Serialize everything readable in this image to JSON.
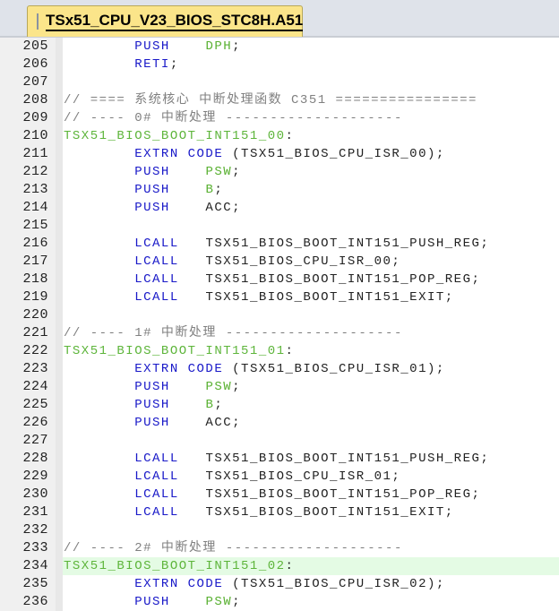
{
  "tab": {
    "title": "TSx51_CPU_V23_BIOS_STC8H.A51"
  },
  "colors": {
    "keyword": "#1818c8",
    "operand": "#58b030",
    "comment": "#808080",
    "label": "#5db53a",
    "highlight": "#e4fbe4"
  },
  "highlighted_line": 234,
  "lines": [
    {
      "n": "205",
      "s": [
        [
          "        ",
          "tx"
        ],
        [
          "PUSH",
          "kw"
        ],
        [
          "    ",
          "tx"
        ],
        [
          "DPH",
          "op"
        ],
        [
          ";",
          "tx"
        ]
      ]
    },
    {
      "n": "206",
      "s": [
        [
          "        ",
          "tx"
        ],
        [
          "RETI",
          "kw"
        ],
        [
          ";",
          "tx"
        ]
      ]
    },
    {
      "n": "207",
      "s": []
    },
    {
      "n": "208",
      "s": [
        [
          "// ==== 系统核心 中断处理函数 C351 ================",
          "cm"
        ]
      ]
    },
    {
      "n": "209",
      "s": [
        [
          "// ---- 0# 中断处理 --------------------",
          "cm"
        ]
      ]
    },
    {
      "n": "210",
      "s": [
        [
          "TSX51_BIOS_BOOT_INT151_00",
          "lb"
        ],
        [
          ":",
          "tx"
        ]
      ]
    },
    {
      "n": "211",
      "s": [
        [
          "        ",
          "tx"
        ],
        [
          "EXTRN CODE",
          "kw"
        ],
        [
          " (TSX51_BIOS_CPU_ISR_00);",
          "tx"
        ]
      ]
    },
    {
      "n": "212",
      "s": [
        [
          "        ",
          "tx"
        ],
        [
          "PUSH",
          "kw"
        ],
        [
          "    ",
          "tx"
        ],
        [
          "PSW",
          "op"
        ],
        [
          ";",
          "tx"
        ]
      ]
    },
    {
      "n": "213",
      "s": [
        [
          "        ",
          "tx"
        ],
        [
          "PUSH",
          "kw"
        ],
        [
          "    ",
          "tx"
        ],
        [
          "B",
          "op"
        ],
        [
          ";",
          "tx"
        ]
      ]
    },
    {
      "n": "214",
      "s": [
        [
          "        ",
          "tx"
        ],
        [
          "PUSH",
          "kw"
        ],
        [
          "    ACC;",
          "tx"
        ]
      ]
    },
    {
      "n": "215",
      "s": []
    },
    {
      "n": "216",
      "s": [
        [
          "        ",
          "tx"
        ],
        [
          "LCALL",
          "kw"
        ],
        [
          "   TSX51_BIOS_BOOT_INT151_PUSH_REG;",
          "tx"
        ]
      ]
    },
    {
      "n": "217",
      "s": [
        [
          "        ",
          "tx"
        ],
        [
          "LCALL",
          "kw"
        ],
        [
          "   TSX51_BIOS_CPU_ISR_00;",
          "tx"
        ]
      ]
    },
    {
      "n": "218",
      "s": [
        [
          "        ",
          "tx"
        ],
        [
          "LCALL",
          "kw"
        ],
        [
          "   TSX51_BIOS_BOOT_INT151_POP_REG;",
          "tx"
        ]
      ]
    },
    {
      "n": "219",
      "s": [
        [
          "        ",
          "tx"
        ],
        [
          "LCALL",
          "kw"
        ],
        [
          "   TSX51_BIOS_BOOT_INT151_EXIT;",
          "tx"
        ]
      ]
    },
    {
      "n": "220",
      "s": []
    },
    {
      "n": "221",
      "s": [
        [
          "// ---- 1# 中断处理 --------------------",
          "cm"
        ]
      ]
    },
    {
      "n": "222",
      "s": [
        [
          "TSX51_BIOS_BOOT_INT151_01",
          "lb"
        ],
        [
          ":",
          "tx"
        ]
      ]
    },
    {
      "n": "223",
      "s": [
        [
          "        ",
          "tx"
        ],
        [
          "EXTRN CODE",
          "kw"
        ],
        [
          " (TSX51_BIOS_CPU_ISR_01);",
          "tx"
        ]
      ]
    },
    {
      "n": "224",
      "s": [
        [
          "        ",
          "tx"
        ],
        [
          "PUSH",
          "kw"
        ],
        [
          "    ",
          "tx"
        ],
        [
          "PSW",
          "op"
        ],
        [
          ";",
          "tx"
        ]
      ]
    },
    {
      "n": "225",
      "s": [
        [
          "        ",
          "tx"
        ],
        [
          "PUSH",
          "kw"
        ],
        [
          "    ",
          "tx"
        ],
        [
          "B",
          "op"
        ],
        [
          ";",
          "tx"
        ]
      ]
    },
    {
      "n": "226",
      "s": [
        [
          "        ",
          "tx"
        ],
        [
          "PUSH",
          "kw"
        ],
        [
          "    ACC;",
          "tx"
        ]
      ]
    },
    {
      "n": "227",
      "s": []
    },
    {
      "n": "228",
      "s": [
        [
          "        ",
          "tx"
        ],
        [
          "LCALL",
          "kw"
        ],
        [
          "   TSX51_BIOS_BOOT_INT151_PUSH_REG;",
          "tx"
        ]
      ]
    },
    {
      "n": "229",
      "s": [
        [
          "        ",
          "tx"
        ],
        [
          "LCALL",
          "kw"
        ],
        [
          "   TSX51_BIOS_CPU_ISR_01;",
          "tx"
        ]
      ]
    },
    {
      "n": "230",
      "s": [
        [
          "        ",
          "tx"
        ],
        [
          "LCALL",
          "kw"
        ],
        [
          "   TSX51_BIOS_BOOT_INT151_POP_REG;",
          "tx"
        ]
      ]
    },
    {
      "n": "231",
      "s": [
        [
          "        ",
          "tx"
        ],
        [
          "LCALL",
          "kw"
        ],
        [
          "   TSX51_BIOS_BOOT_INT151_EXIT;",
          "tx"
        ]
      ]
    },
    {
      "n": "232",
      "s": []
    },
    {
      "n": "233",
      "s": [
        [
          "// ---- 2# 中断处理 --------------------",
          "cm"
        ]
      ]
    },
    {
      "n": "234",
      "s": [
        [
          "TSX51_BIOS_BOOT_INT151_02",
          "lb"
        ],
        [
          ":",
          "tx"
        ]
      ]
    },
    {
      "n": "235",
      "s": [
        [
          "        ",
          "tx"
        ],
        [
          "EXTRN CODE",
          "kw"
        ],
        [
          " (TSX51_BIOS_CPU_ISR_02);",
          "tx"
        ]
      ]
    },
    {
      "n": "236",
      "s": [
        [
          "        ",
          "tx"
        ],
        [
          "PUSH",
          "kw"
        ],
        [
          "    ",
          "tx"
        ],
        [
          "PSW",
          "op"
        ],
        [
          ";",
          "tx"
        ]
      ]
    }
  ]
}
